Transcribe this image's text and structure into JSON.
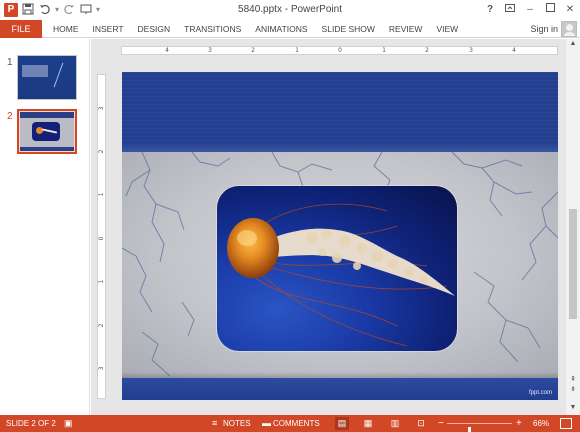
{
  "window": {
    "title": "5840.pptx - PowerPoint",
    "help_label": "?",
    "minimize_label": "–",
    "close_label": "✕"
  },
  "quick_access": {
    "app_icon": "P",
    "save_icon": "save-icon",
    "undo_icon": "undo-icon",
    "redo_icon": "redo-icon",
    "customize_icon": "customize-icon"
  },
  "ribbon": {
    "file_label": "FILE",
    "tabs": [
      {
        "label": "HOME"
      },
      {
        "label": "INSERT"
      },
      {
        "label": "DESIGN"
      },
      {
        "label": "TRANSITIONS"
      },
      {
        "label": "ANIMATIONS"
      },
      {
        "label": "SLIDE SHOW"
      },
      {
        "label": "REVIEW"
      },
      {
        "label": "VIEW"
      }
    ],
    "signin_label": "Sign in"
  },
  "thumbnails": {
    "items": [
      {
        "number": "1",
        "active": false
      },
      {
        "number": "2",
        "active": true
      }
    ]
  },
  "ruler": {
    "horizontal_labels": [
      "4",
      "3",
      "2",
      "1",
      "0",
      "1",
      "2",
      "3",
      "4"
    ],
    "vertical_labels": [
      "3",
      "2",
      "1",
      "0",
      "1",
      "2",
      "3"
    ]
  },
  "slide": {
    "footer_text": "fppt.com"
  },
  "status": {
    "slide_indicator": "SLIDE 2 OF 2",
    "notes_label": "NOTES",
    "comments_label": "COMMENTS",
    "zoom_level": "66%",
    "zoom_fraction": 0.66,
    "accent_color": "#d24726"
  }
}
